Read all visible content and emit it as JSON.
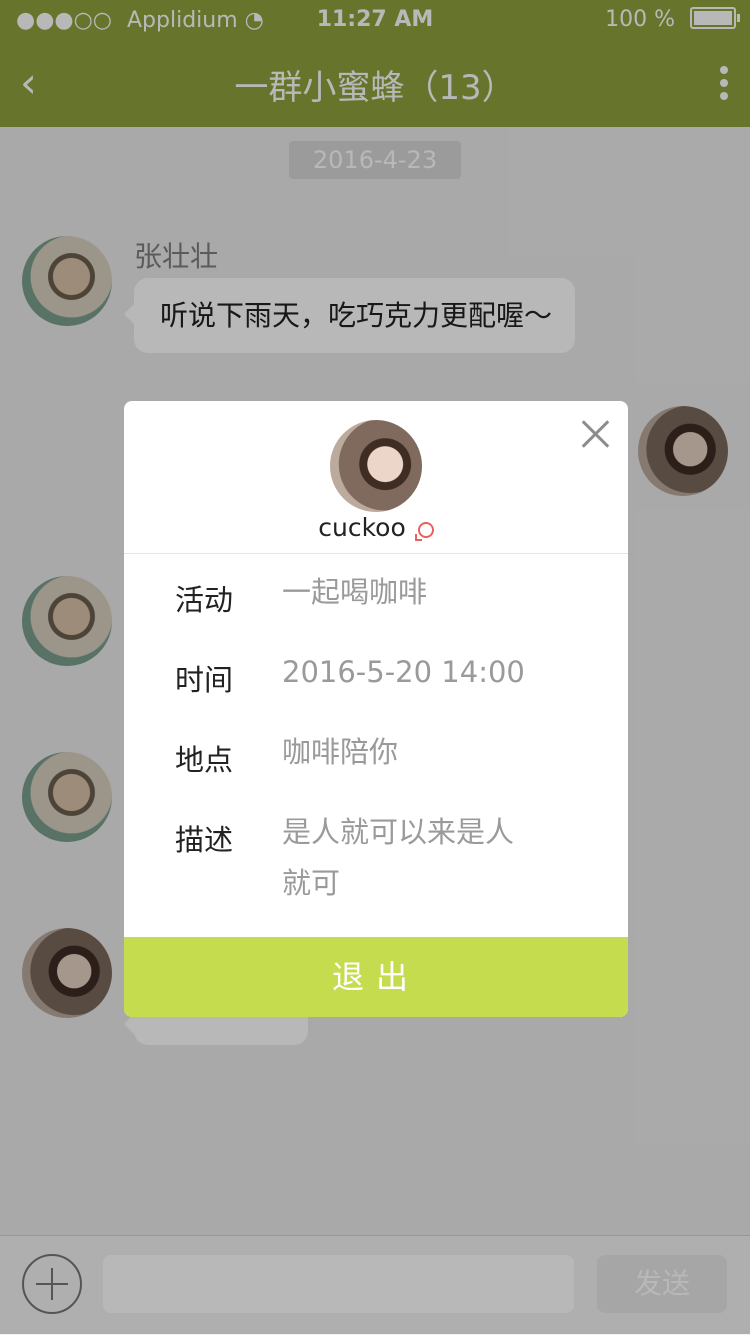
{
  "status": {
    "carrier": "Applidium",
    "time": "11:27 AM",
    "battery": "100 %"
  },
  "header": {
    "title": "一群小蜜蜂（13）"
  },
  "chat": {
    "date": "2016-4-23",
    "messages": [
      {
        "name": "张壮壮",
        "text": "听说下雨天，吃巧克力更配喔～"
      }
    ]
  },
  "modal": {
    "username": "cuckoo",
    "fields": [
      {
        "label": "活动",
        "value": "一起喝咖啡"
      },
      {
        "label": "时间",
        "value": "2016-5-20 14:00"
      },
      {
        "label": "地点",
        "value": "咖啡陪你"
      },
      {
        "label": "描述",
        "value": "是人就可以来是人就可"
      }
    ],
    "button": "退出"
  },
  "input": {
    "send": "发送"
  },
  "colors": {
    "header": "#8ea23c",
    "accent": "#c6dc4f"
  }
}
